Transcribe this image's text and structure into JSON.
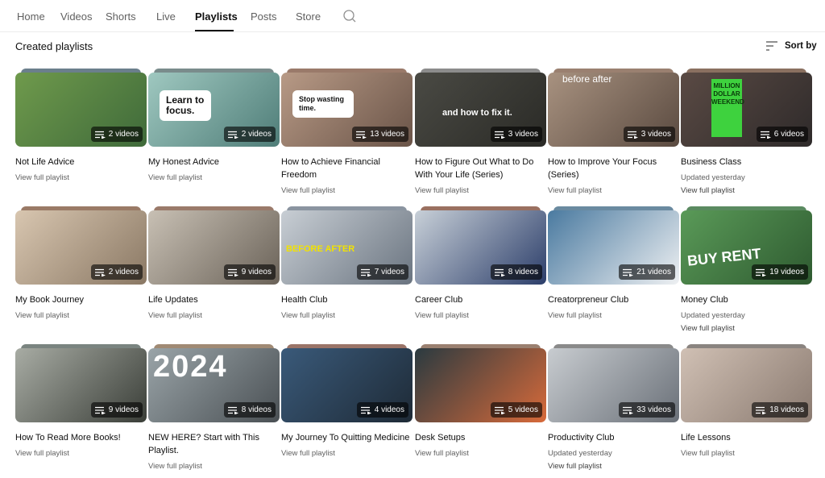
{
  "tabs": [
    {
      "label": "Home",
      "active": false
    },
    {
      "label": "Videos",
      "active": false
    },
    {
      "label": "Shorts",
      "active": false
    },
    {
      "label": "Live",
      "active": false
    },
    {
      "label": "Playlists",
      "active": true
    },
    {
      "label": "Posts",
      "active": false
    },
    {
      "label": "Store",
      "active": false
    }
  ],
  "search_icon": "search-icon",
  "section": {
    "title": "Created playlists",
    "sort_label": "Sort by",
    "sort_icon": "sort-icon"
  },
  "badge_icon": "playlist-icon",
  "view_link_label": "View full playlist",
  "playlists": [
    {
      "title": "Not Life Advice",
      "count": "2 videos",
      "updated": "",
      "stack_color": "#6b7f8c",
      "bg": [
        "#6f9a4c",
        "#3f6a3a"
      ],
      "overlay": ""
    },
    {
      "title": "My Honest Advice",
      "count": "2 videos",
      "updated": "",
      "stack_color": "#7a8c8c",
      "bg": [
        "#9fc8c0",
        "#4f7d78"
      ],
      "overlay": "Learn to focus."
    },
    {
      "title": "How to Achieve Financial Freedom",
      "count": "13 videos",
      "updated": "",
      "stack_color": "#9a7a6a",
      "bg": [
        "#b89a86",
        "#6a5448"
      ],
      "overlay": "Stop wasting time."
    },
    {
      "title": "How to Figure Out What to Do With Your Life (Series)",
      "count": "3 videos",
      "updated": "",
      "stack_color": "#8c8c8c",
      "bg": [
        "#4a4a44",
        "#2a2a26"
      ],
      "overlay": "and how to fix it."
    },
    {
      "title": "How to Improve Your Focus (Series)",
      "count": "3 videos",
      "updated": "",
      "stack_color": "#9a8070",
      "bg": [
        "#a89280",
        "#5a4a40"
      ],
      "overlay": "before      after"
    },
    {
      "title": "Business Class",
      "count": "6 videos",
      "updated": "Updated yesterday",
      "stack_color": "#8a7060",
      "bg": [
        "#5a4a44",
        "#2e2a2a"
      ],
      "overlay": "MILLION DOLLAR WEEKEND"
    },
    {
      "title": "My Book Journey",
      "count": "2 videos",
      "updated": "",
      "stack_color": "#9a7a66",
      "bg": [
        "#d8c6b0",
        "#8a7864"
      ],
      "overlay": ""
    },
    {
      "title": "Life Updates",
      "count": "9 videos",
      "updated": "",
      "stack_color": "#9a7a6a",
      "bg": [
        "#c8c0b4",
        "#6a6258"
      ],
      "overlay": ""
    },
    {
      "title": "Health Club",
      "count": "7 videos",
      "updated": "",
      "stack_color": "#8a94a0",
      "bg": [
        "#c8ced4",
        "#6a7480"
      ],
      "overlay": "BEFORE        AFTER"
    },
    {
      "title": "Career Club",
      "count": "8 videos",
      "updated": "",
      "stack_color": "#9a7060",
      "bg": [
        "#c8d0d8",
        "#2c3e6a"
      ],
      "overlay": ""
    },
    {
      "title": "Creatorpreneur Club",
      "count": "21 videos",
      "updated": "",
      "stack_color": "#6a8aa0",
      "bg": [
        "#4a7aa0",
        "#eef0f2"
      ],
      "overlay": ""
    },
    {
      "title": "Money Club",
      "count": "19 videos",
      "updated": "Updated yesterday",
      "stack_color": "#5a8a60",
      "bg": [
        "#5a9a58",
        "#2e5a30"
      ],
      "overlay": "BUY   RENT"
    },
    {
      "title": "How To Read More Books!",
      "count": "9 videos",
      "updated": "",
      "stack_color": "#7a8480",
      "bg": [
        "#a8aca4",
        "#3a3e38"
      ],
      "overlay": ""
    },
    {
      "title": "NEW HERE? Start with This Playlist.",
      "count": "8 videos",
      "updated": "",
      "stack_color": "#a08a74",
      "bg": [
        "#9aa4a8",
        "#4a5054"
      ],
      "overlay": "2024"
    },
    {
      "title": "My Journey To Quitting Medicine",
      "count": "4 videos",
      "updated": "",
      "stack_color": "#9a7468",
      "bg": [
        "#3a5a7a",
        "#1e2a36"
      ],
      "overlay": ""
    },
    {
      "title": "Desk Setups",
      "count": "5 videos",
      "updated": "",
      "stack_color": "#9a8070",
      "bg": [
        "#2a3a40",
        "#d86a3a"
      ],
      "overlay": ""
    },
    {
      "title": "Productivity Club",
      "count": "33 videos",
      "updated": "Updated yesterday",
      "stack_color": "#8a8a8a",
      "bg": [
        "#c8ccd0",
        "#6a7078"
      ],
      "overlay": ""
    },
    {
      "title": "Life Lessons",
      "count": "18 videos",
      "updated": "",
      "stack_color": "#8a8480",
      "bg": [
        "#d0c0b4",
        "#8a7a70"
      ],
      "overlay": ""
    }
  ]
}
